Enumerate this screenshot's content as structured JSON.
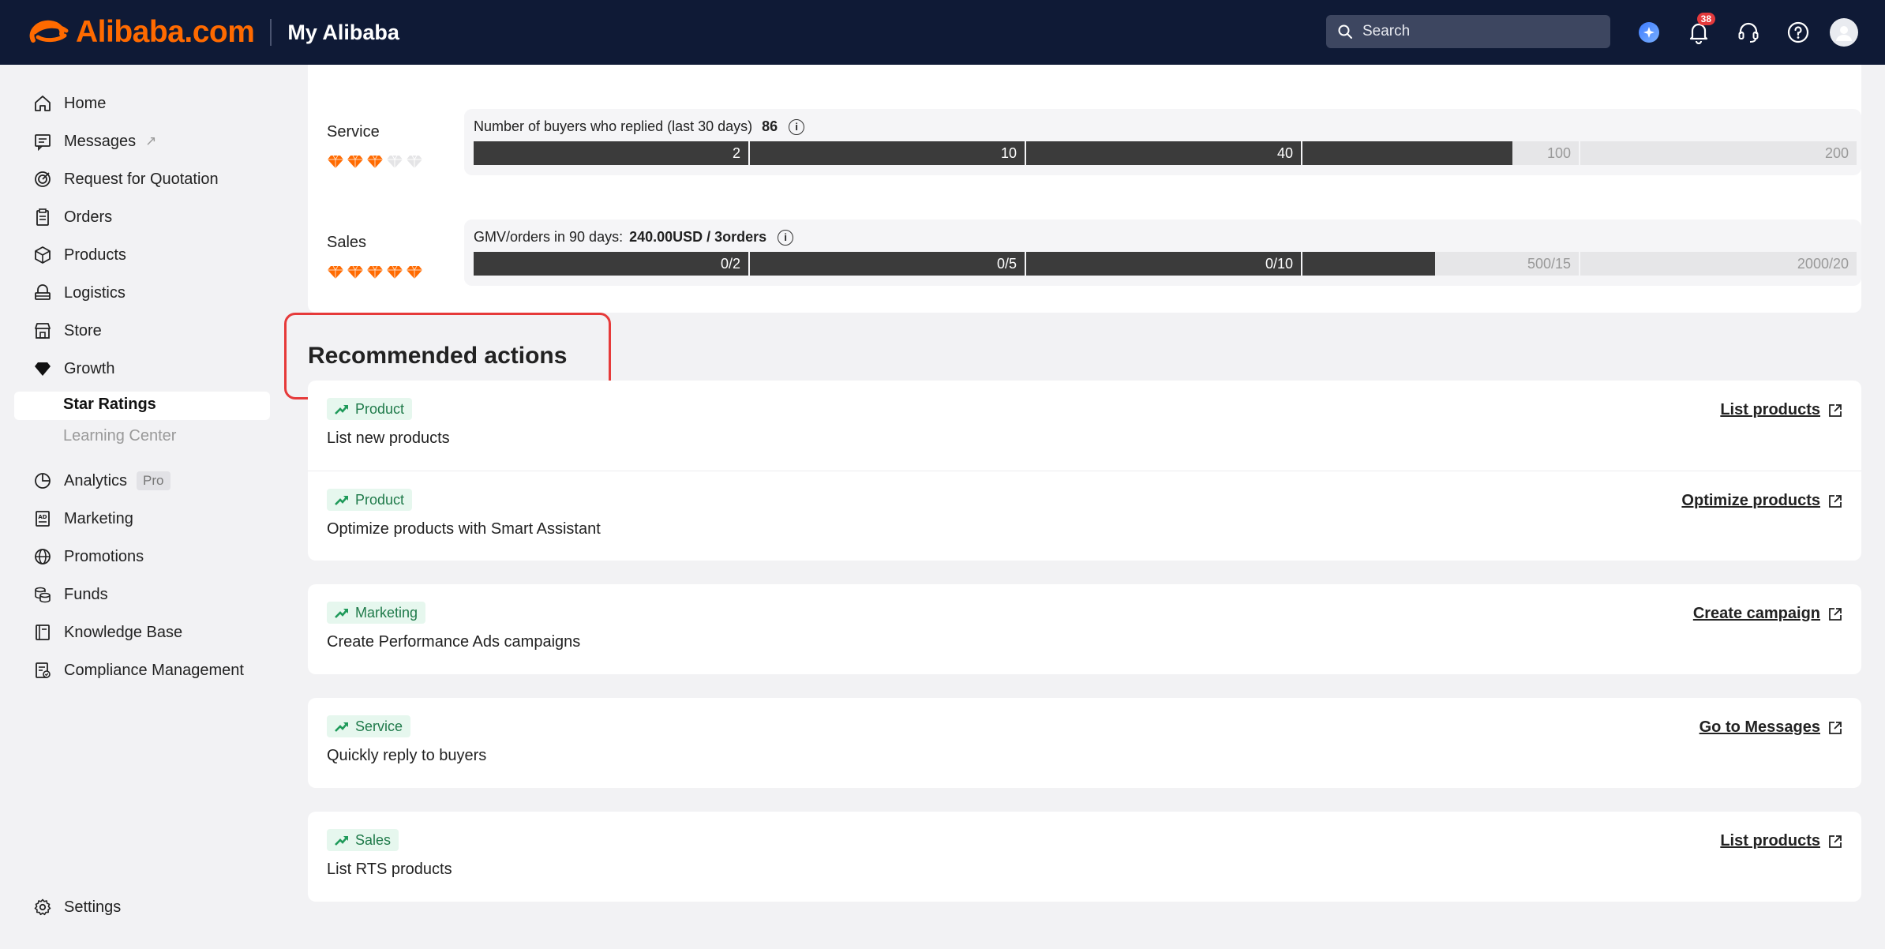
{
  "header": {
    "logo_text": "Alibaba.com",
    "title": "My Alibaba",
    "search_placeholder": "Search",
    "notification_count": "38",
    "brand_color": "#ff6a00",
    "bg_color": "#0f1a36"
  },
  "sidebar": {
    "items": [
      {
        "label": "Home",
        "icon": "home-icon"
      },
      {
        "label": "Messages",
        "icon": "message-icon"
      },
      {
        "label": "Request for Quotation",
        "icon": "target-icon"
      },
      {
        "label": "Orders",
        "icon": "clipboard-icon"
      },
      {
        "label": "Products",
        "icon": "box-icon"
      },
      {
        "label": "Logistics",
        "icon": "truck-icon"
      },
      {
        "label": "Store",
        "icon": "store-icon"
      },
      {
        "label": "Growth",
        "icon": "diamond-icon"
      },
      {
        "label": "Analytics",
        "icon": "pie-chart-icon",
        "tag": "Pro"
      },
      {
        "label": "Marketing",
        "icon": "ad-icon"
      },
      {
        "label": "Promotions",
        "icon": "globe-icon"
      },
      {
        "label": "Funds",
        "icon": "coins-icon"
      },
      {
        "label": "Knowledge Base",
        "icon": "book-icon"
      },
      {
        "label": "Compliance Management",
        "icon": "compliance-icon"
      }
    ],
    "growth_sub": [
      {
        "label": "Star Ratings",
        "active": true
      },
      {
        "label": "Learning Center",
        "active": false
      }
    ],
    "settings": {
      "label": "Settings",
      "icon": "gear-icon"
    }
  },
  "ratings": {
    "service": {
      "label": "Service",
      "filled_diamonds": 3,
      "total_diamonds": 5,
      "metric_label": "Number of buyers who replied (last 30 days)",
      "metric_value": "86",
      "thresholds": [
        "2",
        "10",
        "40",
        "100",
        "200"
      ],
      "progress_in_segment_4": 0.76
    },
    "sales": {
      "label": "Sales",
      "filled_diamonds": 5,
      "total_diamonds": 5,
      "metric_label": "GMV/orders in 90 days:",
      "metric_value": "240.00USD / 3orders",
      "thresholds": [
        "0/2",
        "0/5",
        "0/10",
        "500/15",
        "2000/20"
      ],
      "progress_in_segment_4": 0.48
    }
  },
  "recommended": {
    "title": "Recommended actions",
    "tag_color": "#1f7a4a",
    "actions": [
      {
        "tag": "Product",
        "desc": "List new products",
        "link": "List products"
      },
      {
        "tag": "Product",
        "desc": "Optimize products with Smart Assistant",
        "link": "Optimize products"
      },
      {
        "tag": "Marketing",
        "desc": "Create Performance Ads campaigns",
        "link": "Create campaign"
      },
      {
        "tag": "Service",
        "desc": "Quickly reply to buyers",
        "link": "Go to Messages"
      },
      {
        "tag": "Sales",
        "desc": "List RTS products",
        "link": "List products"
      }
    ]
  }
}
